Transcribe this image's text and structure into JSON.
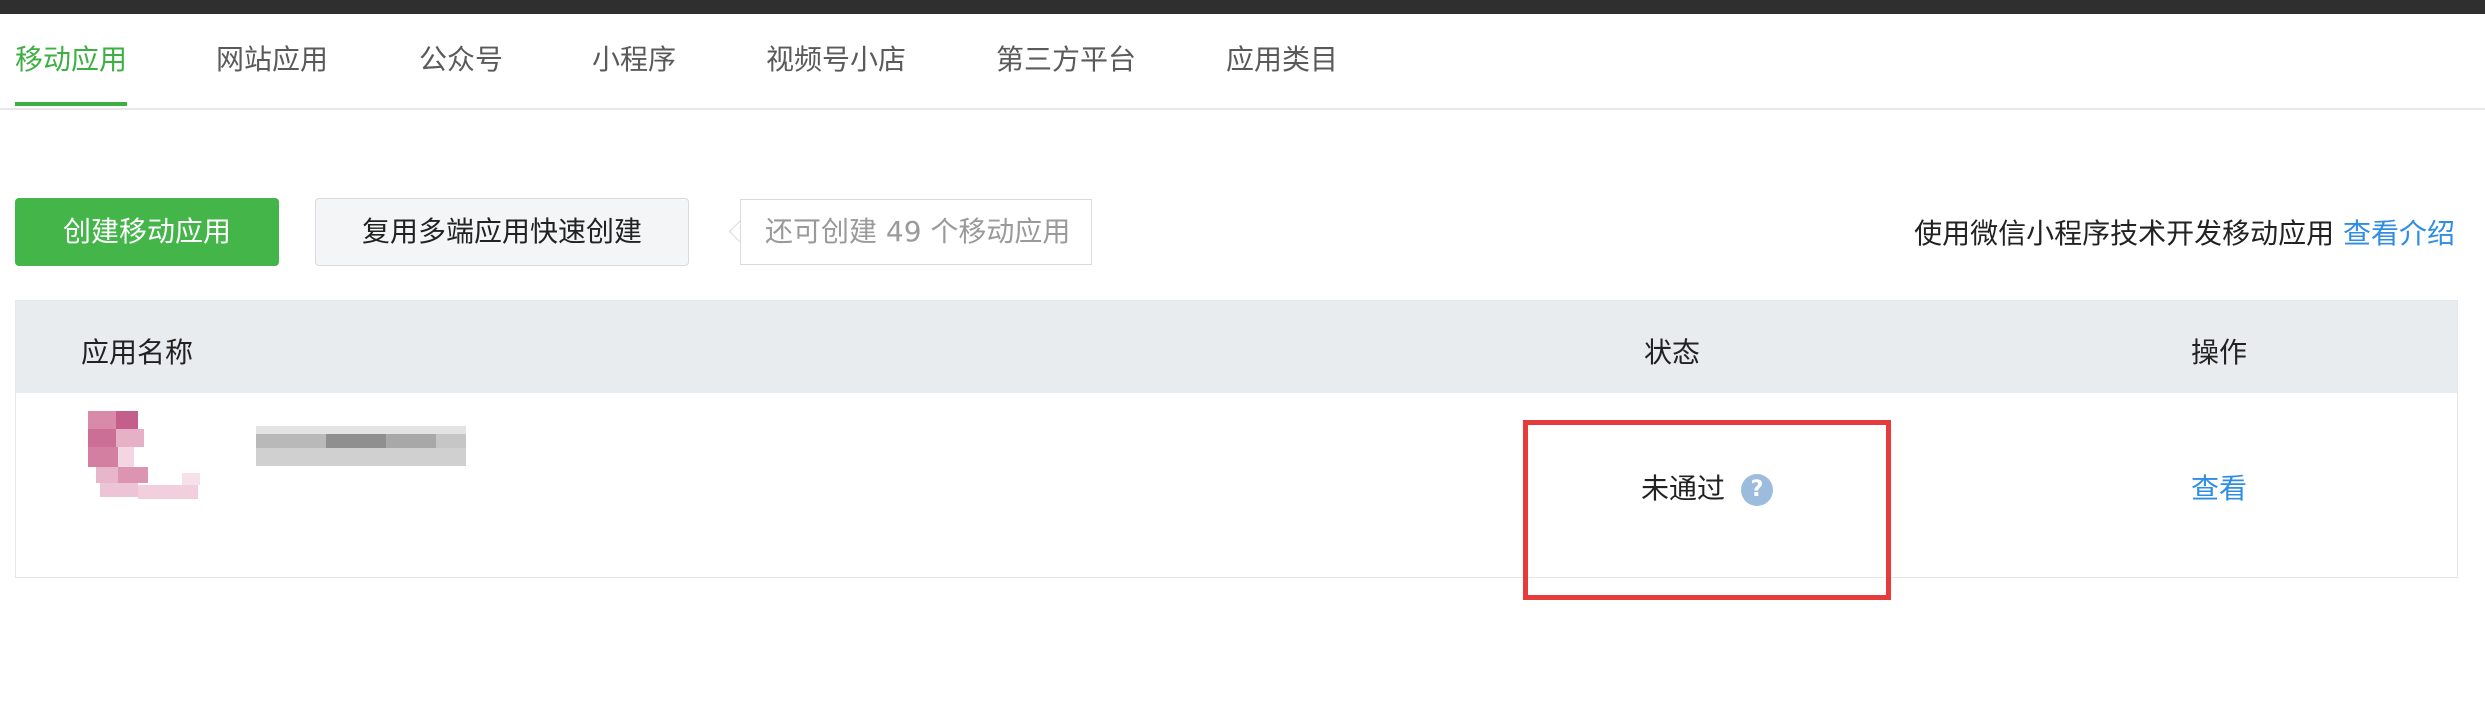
{
  "tabs": [
    {
      "label": "移动应用",
      "active": true
    },
    {
      "label": "网站应用",
      "active": false
    },
    {
      "label": "公众号",
      "active": false
    },
    {
      "label": "小程序",
      "active": false
    },
    {
      "label": "视频号小店",
      "active": false
    },
    {
      "label": "第三方平台",
      "active": false
    },
    {
      "label": "应用类目",
      "active": false
    }
  ],
  "toolbar": {
    "create_label": "创建移动应用",
    "reuse_label": "复用多端应用快速创建",
    "quota_text": "还可创建 49 个移动应用",
    "hint_text": "使用微信小程序技术开发移动应用",
    "hint_link": "查看介绍"
  },
  "table": {
    "headers": {
      "name": "应用名称",
      "status": "状态",
      "action": "操作"
    },
    "rows": [
      {
        "status": "未通过",
        "help": "?",
        "action": "查看"
      }
    ]
  },
  "colors": {
    "accent_green": "#44b549",
    "link_blue": "#2f8de4",
    "highlight_red": "#e63b3b"
  }
}
